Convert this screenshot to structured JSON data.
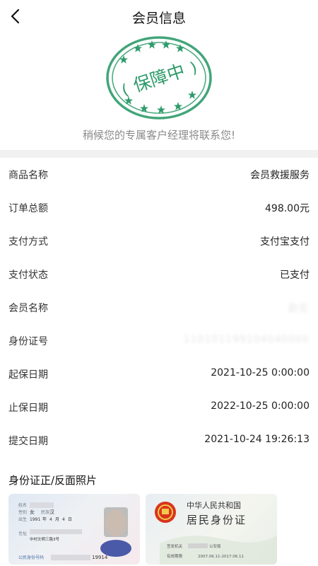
{
  "header": {
    "title": "会员信息",
    "back_icon": "chevron-left-icon"
  },
  "stamp": {
    "text": "保障中",
    "color": "#2e9b6a"
  },
  "notice": "稍候您的专属客户经理将联系您!",
  "details": [
    {
      "label": "商品名称",
      "value": "会员救援服务"
    },
    {
      "label": "订单总额",
      "value": "498.00元"
    },
    {
      "label": "支付方式",
      "value": "支付宝支付"
    },
    {
      "label": "支付状态",
      "value": "已支付"
    },
    {
      "label": "会员名称",
      "value": "赵伦"
    },
    {
      "label": "身份证号",
      "value": "110101199104040000"
    },
    {
      "label": "起保日期",
      "value": "2021-10-25 0:00:00"
    },
    {
      "label": "止保日期",
      "value": "2022-10-25 0:00:00"
    },
    {
      "label": "提交日期",
      "value": "2021-10-24 19:26:13"
    }
  ],
  "id_section": {
    "title": "身份证正/反面照片",
    "front": {
      "name_label": "姓名",
      "gender_label": "性别",
      "gender": "女",
      "ethnicity_label": "民族",
      "ethnicity": "汉",
      "birth_label": "出生",
      "birth_year": "1991",
      "year_unit": "年",
      "birth_month": "4",
      "month_unit": "月",
      "birth_day": "4",
      "day_unit": "日",
      "address_label": "住址",
      "address": "中村文明三路3号",
      "id_label": "公民身份号码",
      "id_partial": "19914"
    },
    "back": {
      "country": "中华人民共和国",
      "card_name": "居民身份证",
      "authority_label": "签发机关",
      "authority": "公安局",
      "validity_label": "有效期限",
      "validity": "2007.06.11-2017.06.11"
    }
  },
  "colors": {
    "accent_green": "#2e9b6a",
    "separator": "#f1f1f1",
    "muted_text": "#8a8a8a",
    "national_red": "#d9341d"
  }
}
